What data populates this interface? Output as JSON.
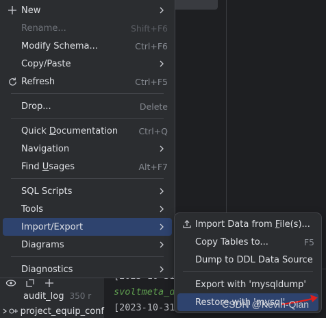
{
  "menu": {
    "items": [
      {
        "label": "New",
        "shortcut": "",
        "submenu": true,
        "icon": "plus-icon",
        "disabled": false
      },
      {
        "label": "Rename...",
        "shortcut": "Shift+F6",
        "submenu": false,
        "icon": "",
        "disabled": true
      },
      {
        "label": "Modify Schema...",
        "shortcut": "Ctrl+F6",
        "submenu": false,
        "icon": "",
        "disabled": false
      },
      {
        "label": "Copy/Paste",
        "shortcut": "",
        "submenu": true,
        "icon": "",
        "disabled": false
      },
      {
        "label": "Refresh",
        "shortcut": "Ctrl+F5",
        "submenu": false,
        "icon": "refresh-icon",
        "disabled": false
      },
      {
        "label": "Drop...",
        "shortcut": "Delete",
        "submenu": false,
        "icon": "",
        "disabled": false
      },
      {
        "label_pre": "Quick ",
        "label_u": "D",
        "label_post": "ocumentation",
        "shortcut": "Ctrl+Q",
        "submenu": false
      },
      {
        "label": "Navigation",
        "shortcut": "",
        "submenu": true
      },
      {
        "label_pre": "Find ",
        "label_u": "U",
        "label_post": "sages",
        "shortcut": "Alt+F7",
        "submenu": false
      },
      {
        "label": "SQL Scripts",
        "shortcut": "",
        "submenu": true
      },
      {
        "label": "Tools",
        "shortcut": "",
        "submenu": true
      },
      {
        "label": "Import/Export",
        "shortcut": "",
        "submenu": true,
        "selected": true
      },
      {
        "label": "Diagrams",
        "shortcut": "",
        "submenu": true
      },
      {
        "label": "Diagnostics",
        "shortcut": "",
        "submenu": true
      }
    ]
  },
  "submenu": {
    "items": [
      {
        "label_pre": "Import Data from ",
        "label_u": "F",
        "label_post": "ile(s)...",
        "shortcut": "",
        "icon": "import-icon"
      },
      {
        "label": "Copy Tables to...",
        "shortcut": "F5"
      },
      {
        "label": "Dump to DDL Data Source",
        "shortcut": ""
      },
      {
        "label": "Export with 'mysqldump'",
        "shortcut": ""
      },
      {
        "label": "Restore with 'mysql'",
        "shortcut": "",
        "selected": true
      }
    ]
  },
  "console": {
    "lines": [
      "[2023-10-31",
      "svoltmeta_d",
      "[2023-10-31"
    ]
  },
  "tree": {
    "row1_label": "audit_log",
    "row1_meta": "350 r",
    "row2_label": "project_equip_conf"
  },
  "watermark": "CSDN @Kevin-Qian",
  "colors": {
    "selection": "#2e436e",
    "menu_bg": "#2b2d30",
    "arrow_red": "#e0201c"
  }
}
